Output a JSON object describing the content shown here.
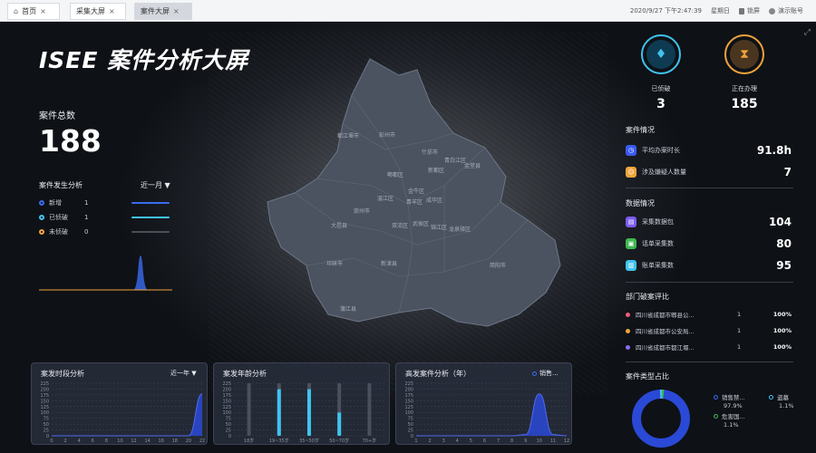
{
  "tabs": [
    {
      "label": "首页",
      "close": "×"
    },
    {
      "label": "采集大屏",
      "close": "×"
    },
    {
      "label": "案件大屏",
      "close": "×"
    }
  ],
  "topbar": {
    "datetime": "2020/9/27 下午2:47:39",
    "weekday": "星期日",
    "lock": "锁屏",
    "account": "演示账号"
  },
  "title": "ISEE 案件分析大屏",
  "total": {
    "label": "案件总数",
    "value": "188"
  },
  "occurrence": {
    "title": "案件发生分析",
    "range": "近一月 ▼",
    "legend": [
      {
        "label": "新增",
        "count": "1",
        "color": "#3b6cf0"
      },
      {
        "label": "已侦破",
        "count": "1",
        "color": "#3fc3f0"
      },
      {
        "label": "未侦破",
        "count": "0",
        "color": "#f0a33b"
      }
    ]
  },
  "map_labels": [
    "彭州市",
    "都江堰市",
    "什邡市",
    "郫都区",
    "新都区",
    "青白江区",
    "金堂县",
    "温江区",
    "成华区",
    "金牛区",
    "青羊区",
    "崇州市",
    "大邑县",
    "双流区",
    "武侯区",
    "锦江区",
    "龙泉驿区",
    "邛崃市",
    "新津县",
    "简阳市",
    "蒲江县"
  ],
  "status": {
    "solved": {
      "label": "已侦破",
      "value": "3"
    },
    "in_progress": {
      "label": "正在办理",
      "value": "185"
    }
  },
  "case_situation": {
    "title": "案件情况",
    "items": [
      {
        "label": "平均办案时长",
        "value": "91.8h",
        "color": "#3b5bf0"
      },
      {
        "label": "涉及嫌疑人数量",
        "value": "7",
        "color": "#f0a33b"
      }
    ]
  },
  "data_situation": {
    "title": "数据情况",
    "items": [
      {
        "label": "采集数据包",
        "value": "104",
        "color": "#7c5cf0"
      },
      {
        "label": "话单采集数",
        "value": "80",
        "color": "#3fb950"
      },
      {
        "label": "账单采集数",
        "value": "95",
        "color": "#3fc3f0"
      }
    ]
  },
  "dept_ratio": {
    "title": "部门破案评比",
    "items": [
      {
        "name": "四川省成都市郫县公...",
        "count": "1",
        "pct": "100%",
        "color": "#f05a7a"
      },
      {
        "name": "四川省成都市公安局...",
        "count": "1",
        "pct": "100%",
        "color": "#f0a33b"
      },
      {
        "name": "四川省成都市都江堰...",
        "count": "1",
        "pct": "100%",
        "color": "#8a6cf0"
      }
    ]
  },
  "case_types": {
    "title": "案件类型占比",
    "legend": [
      {
        "label": "销售禁...",
        "value": "97.9%",
        "color": "#3b6cf0"
      },
      {
        "label": "盗墓",
        "value": "1.1%",
        "color": "#3fc3f0"
      },
      {
        "label": "危害国...",
        "value": "1.1%",
        "color": "#3fb950"
      }
    ]
  },
  "chart_data": [
    {
      "type": "area",
      "title": "案发时段分析",
      "range": "近一年 ▼",
      "x": [
        "0",
        "2",
        "4",
        "6",
        "8",
        "10",
        "12",
        "14",
        "16",
        "18",
        "20",
        "22"
      ],
      "y_ticks": [
        "0",
        "25",
        "50",
        "75",
        "100",
        "125",
        "150",
        "175",
        "200",
        "225"
      ],
      "ylim": [
        0,
        225
      ],
      "series": [
        {
          "values": [
            0,
            0,
            0,
            0,
            0,
            0,
            0,
            0,
            0,
            0,
            0,
            180
          ],
          "color": "#2a49d6"
        }
      ]
    },
    {
      "type": "bar",
      "title": "案发年龄分析",
      "categories": [
        "18岁",
        "19~35岁",
        "35~50岁",
        "50~70岁",
        "70+岁"
      ],
      "y_ticks": [
        "0",
        "25",
        "50",
        "75",
        "100",
        "125",
        "150",
        "175",
        "200",
        "225"
      ],
      "ylim": [
        0,
        225
      ],
      "values": [
        0,
        200,
        200,
        100,
        0
      ],
      "color": "#3fc3f0"
    },
    {
      "type": "area",
      "title": "高发案件分析（年）",
      "legend": "销售...",
      "x": [
        "1",
        "2",
        "3",
        "4",
        "5",
        "6",
        "7",
        "8",
        "9",
        "10",
        "11",
        "12"
      ],
      "y_ticks": [
        "0",
        "25",
        "50",
        "75",
        "100",
        "125",
        "150",
        "175",
        "200",
        "225"
      ],
      "ylim": [
        0,
        225
      ],
      "series": [
        {
          "name": "销售...",
          "values": [
            0,
            0,
            0,
            0,
            0,
            0,
            0,
            0,
            5,
            180,
            5,
            0
          ],
          "color": "#2a49d6"
        }
      ]
    }
  ]
}
